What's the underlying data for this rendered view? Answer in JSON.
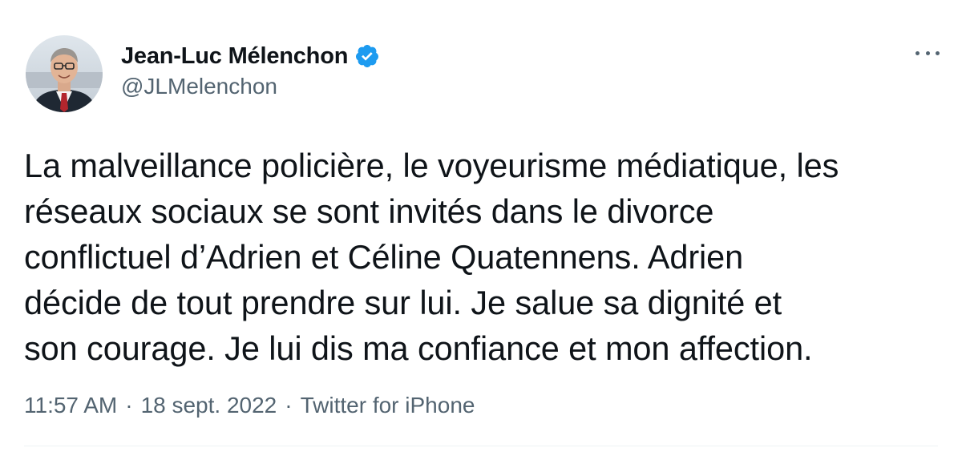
{
  "author": {
    "display_name": "Jean-Luc Mélenchon",
    "handle": "@JLMelenchon",
    "verified": true
  },
  "tweet": {
    "text_lines": [
      "La malveillance policière, le voyeurisme médiatique, les",
      "réseaux sociaux se sont invités dans le divorce",
      "conflictuel d’Adrien et Céline Quatennens. Adrien",
      "décide de tout prendre sur lui. Je salue sa dignité et",
      "son courage. Je lui dis ma confiance et mon affection."
    ],
    "time": "11:57 AM",
    "date": "18 sept. 2022",
    "separator": "·",
    "source": "Twitter for iPhone"
  },
  "icons": {
    "verified": "verified-badge-icon",
    "more": "more-horizontal-icon"
  },
  "colors": {
    "text_primary": "#0f1419",
    "text_secondary": "#536471",
    "verified_blue": "#1d9bf0",
    "background": "#ffffff"
  }
}
